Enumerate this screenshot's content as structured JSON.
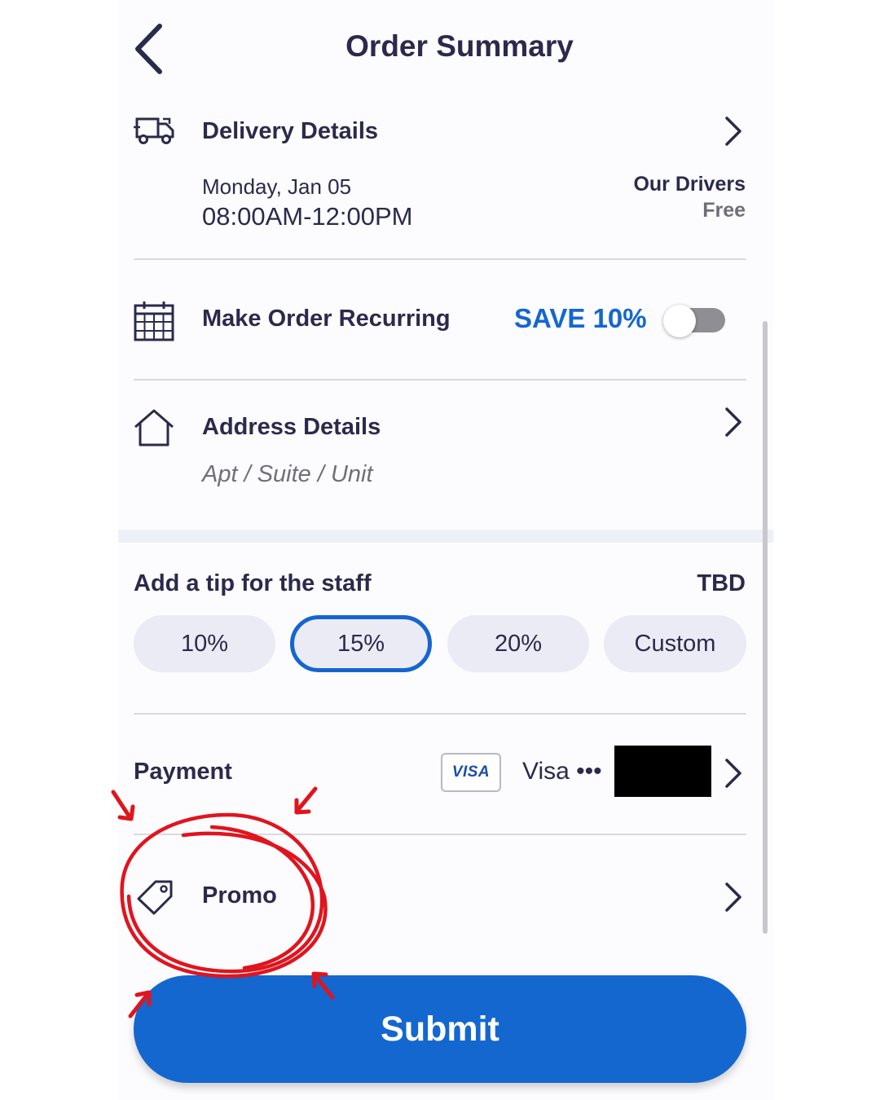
{
  "header": {
    "title": "Order Summary"
  },
  "delivery": {
    "title": "Delivery Details",
    "date": "Monday, Jan 05",
    "time_window": "08:00AM-12:00PM",
    "carrier": "Our Drivers",
    "fee": "Free"
  },
  "recurring": {
    "title": "Make Order Recurring",
    "promo_text": "SAVE 10%",
    "enabled": false
  },
  "address": {
    "title": "Address Details",
    "placeholder": "Apt / Suite / Unit"
  },
  "tip": {
    "title": "Add a tip for the staff",
    "amount": "TBD",
    "options": [
      "10%",
      "15%",
      "20%",
      "Custom"
    ],
    "selected": "15%"
  },
  "payment": {
    "title": "Payment",
    "card_brand_badge": "VISA",
    "card_label": "Visa •••"
  },
  "promo": {
    "title": "Promo"
  },
  "submit": {
    "label": "Submit"
  },
  "colors": {
    "primary_text": "#2b2a4c",
    "accent_blue": "#1467cf",
    "annotation_red": "#e0141e",
    "tip_pill_bg": "#ebebf6"
  },
  "icons": {
    "back": "chevron-left-icon",
    "delivery": "truck-icon",
    "recurring": "calendar-icon",
    "address": "home-icon",
    "promo": "tag-icon",
    "row_arrow": "chevron-right-icon"
  }
}
